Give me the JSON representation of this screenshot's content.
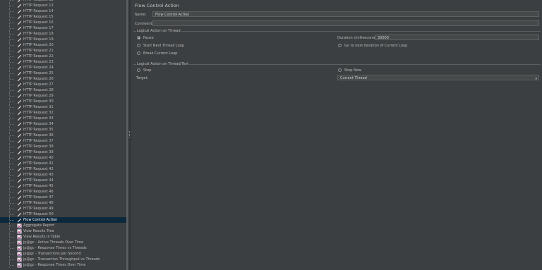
{
  "tree": {
    "items": [
      {
        "label": "HTTP Request 12",
        "icon": "pencil-icon"
      },
      {
        "label": "HTTP Request 13",
        "icon": "pencil-icon"
      },
      {
        "label": "HTTP Request 14",
        "icon": "pencil-icon"
      },
      {
        "label": "HTTP Request 15",
        "icon": "pencil-icon"
      },
      {
        "label": "HTTP Request 16",
        "icon": "pencil-icon"
      },
      {
        "label": "HTTP Request 17",
        "icon": "pencil-icon"
      },
      {
        "label": "HTTP Request 18",
        "icon": "pencil-icon"
      },
      {
        "label": "HTTP Request 19",
        "icon": "pencil-icon"
      },
      {
        "label": "HTTP Request 20",
        "icon": "pencil-icon"
      },
      {
        "label": "HTTP Request 21",
        "icon": "pencil-icon"
      },
      {
        "label": "HTTP Request 22",
        "icon": "pencil-icon"
      },
      {
        "label": "HTTP Request 23",
        "icon": "pencil-icon"
      },
      {
        "label": "HTTP Request 24",
        "icon": "pencil-icon"
      },
      {
        "label": "HTTP Request 25",
        "icon": "pencil-icon"
      },
      {
        "label": "HTTP Request 26",
        "icon": "pencil-icon"
      },
      {
        "label": "HTTP Request 27",
        "icon": "pencil-icon"
      },
      {
        "label": "HTTP Request 28",
        "icon": "pencil-icon"
      },
      {
        "label": "HTTP Request 29",
        "icon": "pencil-icon"
      },
      {
        "label": "HTTP Request 30",
        "icon": "pencil-icon"
      },
      {
        "label": "HTTP Request 31",
        "icon": "pencil-icon"
      },
      {
        "label": "HTTP Request 32",
        "icon": "pencil-icon"
      },
      {
        "label": "HTTP Request 33",
        "icon": "pencil-icon"
      },
      {
        "label": "HTTP Request 34",
        "icon": "pencil-icon"
      },
      {
        "label": "HTTP Request 35",
        "icon": "pencil-icon"
      },
      {
        "label": "HTTP Request 36",
        "icon": "pencil-icon"
      },
      {
        "label": "HTTP Request 37",
        "icon": "pencil-icon"
      },
      {
        "label": "HTTP Request 38",
        "icon": "pencil-icon"
      },
      {
        "label": "HTTP Request 39",
        "icon": "pencil-icon"
      },
      {
        "label": "HTTP Request 40",
        "icon": "pencil-icon"
      },
      {
        "label": "HTTP Request 41",
        "icon": "pencil-icon"
      },
      {
        "label": "HTTP Request 42",
        "icon": "pencil-icon"
      },
      {
        "label": "HTTP Request 43",
        "icon": "pencil-icon"
      },
      {
        "label": "HTTP Request 44",
        "icon": "pencil-icon"
      },
      {
        "label": "HTTP Request 45",
        "icon": "pencil-icon"
      },
      {
        "label": "HTTP Request 46",
        "icon": "pencil-icon"
      },
      {
        "label": "HTTP Request 47",
        "icon": "pencil-icon"
      },
      {
        "label": "HTTP Request 48",
        "icon": "pencil-icon"
      },
      {
        "label": "HTTP Request 49",
        "icon": "pencil-icon"
      },
      {
        "label": "HTTP Request 50",
        "icon": "pencil-icon"
      },
      {
        "label": "Flow Control Action",
        "icon": "pencil-icon",
        "selected": true
      },
      {
        "label": "Aggregate Report",
        "icon": "chart-icon"
      },
      {
        "label": "View Results Tree",
        "icon": "chart-icon"
      },
      {
        "label": "View Results in Table",
        "icon": "chart-icon"
      },
      {
        "label": "jp@gc - Active Threads Over Time",
        "icon": "chart-icon"
      },
      {
        "label": "jp@gc - Response Times vs Threads",
        "icon": "chart-icon"
      },
      {
        "label": "jp@gc - Transactions per Second",
        "icon": "chart-icon"
      },
      {
        "label": "jp@gc - Transaction Throughput vs Threads",
        "icon": "chart-icon"
      },
      {
        "label": "jp@gc - Response Times Over Time",
        "icon": "chart-icon"
      }
    ]
  },
  "panel": {
    "title": "Flow Control Action",
    "name_label": "Name:",
    "name_value": "Flow Control Action",
    "comments_label": "Comments:",
    "comments_value": "",
    "group1": {
      "title": "Logical Action on Thread",
      "pause": "Pause",
      "start_next": "Start Next Thread Loop",
      "break_loop": "Break Current Loop",
      "duration_label": "Duration (milliseconds):",
      "duration_value": "30000",
      "go_next": "Go to next iteration of Current Loop"
    },
    "group2": {
      "title": "Logical Action on Thread/Test",
      "stop": "Stop",
      "stop_now": "Stop Now",
      "target_label": "Target:",
      "target_value": "Current Thread"
    }
  },
  "colors": {
    "background": "#3c3f41",
    "selected_row": "#0d293e",
    "text": "#bbbbbb"
  }
}
